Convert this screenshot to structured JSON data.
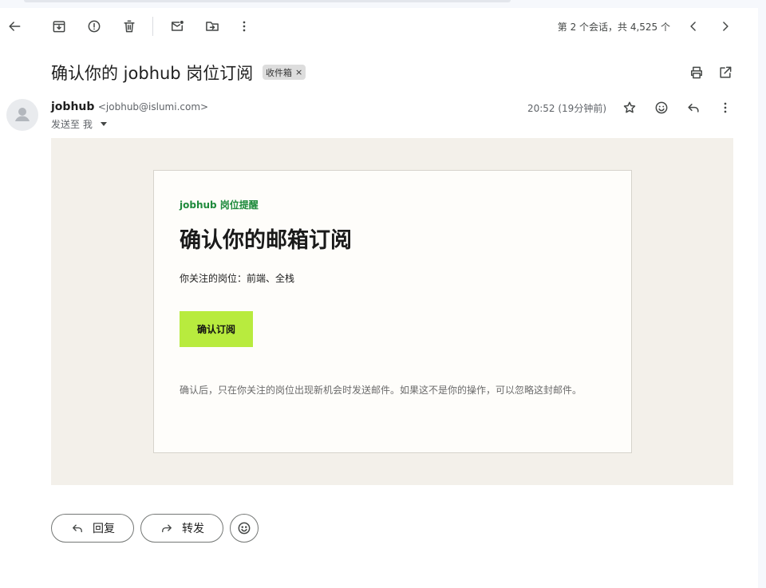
{
  "toolbar": {
    "icons": [
      "back-arrow-icon",
      "archive-icon",
      "report-spam-icon",
      "delete-icon",
      "mark-unread-icon",
      "move-to-icon",
      "more-vert-icon"
    ],
    "counter": "第 2 个会话，共 4,525 个",
    "nav_icons": [
      "chevron-left-icon",
      "chevron-right-icon"
    ]
  },
  "header": {
    "subject": "确认你的 jobhub 岗位订阅",
    "label": "收件箱",
    "label_remove": "×",
    "actions": [
      "print-icon",
      "open-in-new-window-icon"
    ]
  },
  "message": {
    "sender_name": "jobhub",
    "sender_email": "<jobhub@islumi.com>",
    "to_line": "发送至 我",
    "time": "20:52 (19分钟前)",
    "actions": [
      "star-icon",
      "emoji-icon",
      "reply-icon",
      "more-vert-icon"
    ]
  },
  "email_body": {
    "kicker": "jobhub 岗位提醒",
    "headline": "确认你的邮箱订阅",
    "focus_line": "你关注的岗位：前端、全栈",
    "cta_label": "确认订阅",
    "note": "确认后，只在你关注的岗位出现新机会时发送邮件。如果这不是你的操作，可以忽略这封邮件。",
    "colors": {
      "accent_green": "#1e8a3c",
      "cta_bg": "#b8eb3e",
      "outer_bg": "#f3f0ea",
      "card_bg": "#fefdfa"
    }
  },
  "footer": {
    "reply_label": "回复",
    "forward_label": "转发",
    "emoji_icon": "emoji-icon"
  }
}
